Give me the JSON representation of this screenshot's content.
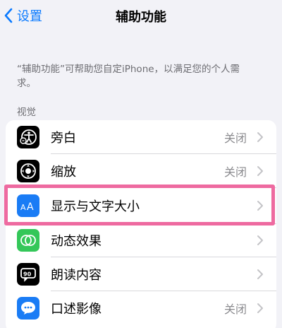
{
  "nav": {
    "back_label": "设置",
    "title": "辅助功能"
  },
  "description": "“辅助功能”可帮助您自定iPhone，以满足您的个人需求。",
  "section": {
    "header": "视觉",
    "items": [
      {
        "label": "旁白",
        "value": "关闭",
        "icon": "voiceover-icon",
        "icon_color": "#000000"
      },
      {
        "label": "缩放",
        "value": "关闭",
        "icon": "zoom-icon",
        "icon_color": "#000000"
      },
      {
        "label": "显示与文字大小",
        "value": "",
        "icon": "text-size-icon",
        "icon_color": "#1a7cf5"
      },
      {
        "label": "动态效果",
        "value": "",
        "icon": "motion-icon",
        "icon_color": "#34c759"
      },
      {
        "label": "朗读内容",
        "value": "",
        "icon": "spoken-content-icon",
        "icon_color": "#000000"
      },
      {
        "label": "口述影像",
        "value": "关闭",
        "icon": "audio-descriptions-icon",
        "icon_color": "#1a7cf5"
      }
    ]
  },
  "colors": {
    "accent": "#0a7aff",
    "highlight": "#ee6aa0",
    "background": "#f2f2f7"
  }
}
